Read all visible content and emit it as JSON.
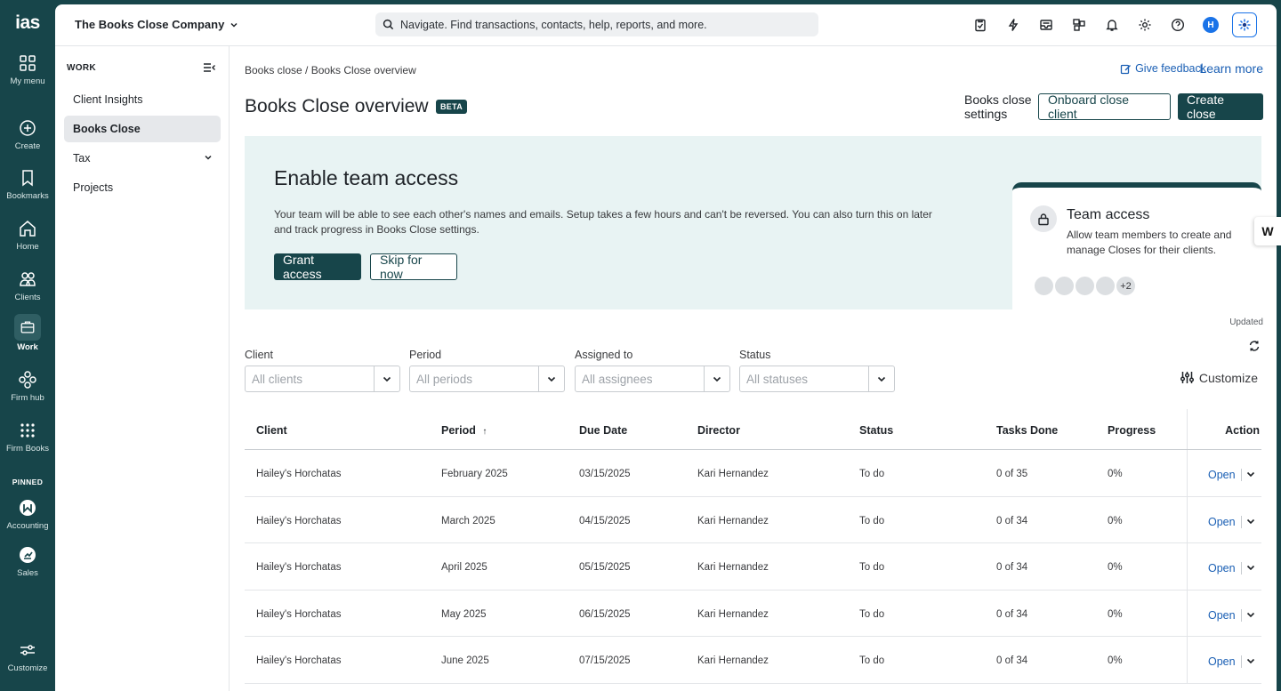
{
  "rail": {
    "logo": "ias",
    "items": [
      {
        "label": "My menu",
        "icon": "grid-icon"
      },
      {
        "label": "Create",
        "icon": "plus-circle-icon"
      },
      {
        "label": "Bookmarks",
        "icon": "bookmark-icon"
      },
      {
        "label": "Home",
        "icon": "home-icon"
      },
      {
        "label": "Clients",
        "icon": "clients-icon"
      },
      {
        "label": "Work",
        "icon": "briefcase-icon"
      },
      {
        "label": "Firm hub",
        "icon": "firm-hub-icon"
      },
      {
        "label": "Firm Books",
        "icon": "dots-grid-icon"
      }
    ],
    "pinned_label": "PINNED",
    "pinned": [
      {
        "label": "Accounting",
        "icon": "accounting-icon"
      },
      {
        "label": "Sales",
        "icon": "sales-icon"
      }
    ],
    "customize_label": "Customize"
  },
  "topbar": {
    "company": "The Books Close Company",
    "search_placeholder": "Navigate. Find transactions, contacts, help, reports, and more.",
    "avatar_initial": "H"
  },
  "subnav": {
    "heading": "WORK",
    "items": [
      "Client Insights",
      "Books Close",
      "Tax",
      "Projects"
    ]
  },
  "content": {
    "breadcrumb": "Books close / Books Close overview",
    "feedback": "Give feedback",
    "learn_more": "Learn more",
    "title": "Books Close overview",
    "beta": "BETA",
    "settings_btn": "Books close settings",
    "onboard_btn": "Onboard close client",
    "create_btn": "Create close"
  },
  "banner": {
    "title": "Enable team access",
    "desc": "Your team will be able to see each other's names and emails. Setup takes a few hours and can't be reversed. You can also turn this on later and track progress in Books Close settings.",
    "grant_btn": "Grant access",
    "skip_btn": "Skip for now",
    "card_title": "Team access",
    "card_desc": "Allow team members to create and manage Closes for their clients.",
    "more_count": "+2"
  },
  "updated_label": "Updated",
  "filters": [
    {
      "label": "Client",
      "placeholder": "All clients"
    },
    {
      "label": "Period",
      "placeholder": "All periods"
    },
    {
      "label": "Assigned to",
      "placeholder": "All assignees"
    },
    {
      "label": "Status",
      "placeholder": "All statuses"
    }
  ],
  "customize_label": "Customize",
  "table": {
    "headers": [
      "Client",
      "Period",
      "Due Date",
      "Director",
      "Status",
      "Tasks Done",
      "Progress",
      "Action"
    ],
    "sort_indicator": "↑",
    "open_label": "Open",
    "rows": [
      [
        "Hailey's Horchatas",
        "February 2025",
        "03/15/2025",
        "Kari Hernandez",
        "To do",
        "0 of 35",
        "0%"
      ],
      [
        "Hailey's Horchatas",
        "March 2025",
        "04/15/2025",
        "Kari Hernandez",
        "To do",
        "0 of 34",
        "0%"
      ],
      [
        "Hailey's Horchatas",
        "April 2025",
        "05/15/2025",
        "Kari Hernandez",
        "To do",
        "0 of 34",
        "0%"
      ],
      [
        "Hailey's Horchatas",
        "May 2025",
        "06/15/2025",
        "Kari Hernandez",
        "To do",
        "0 of 34",
        "0%"
      ],
      [
        "Hailey's Horchatas",
        "June 2025",
        "07/15/2025",
        "Kari Hernandez",
        "To do",
        "0 of 34",
        "0%"
      ]
    ]
  },
  "side_tab": "W"
}
